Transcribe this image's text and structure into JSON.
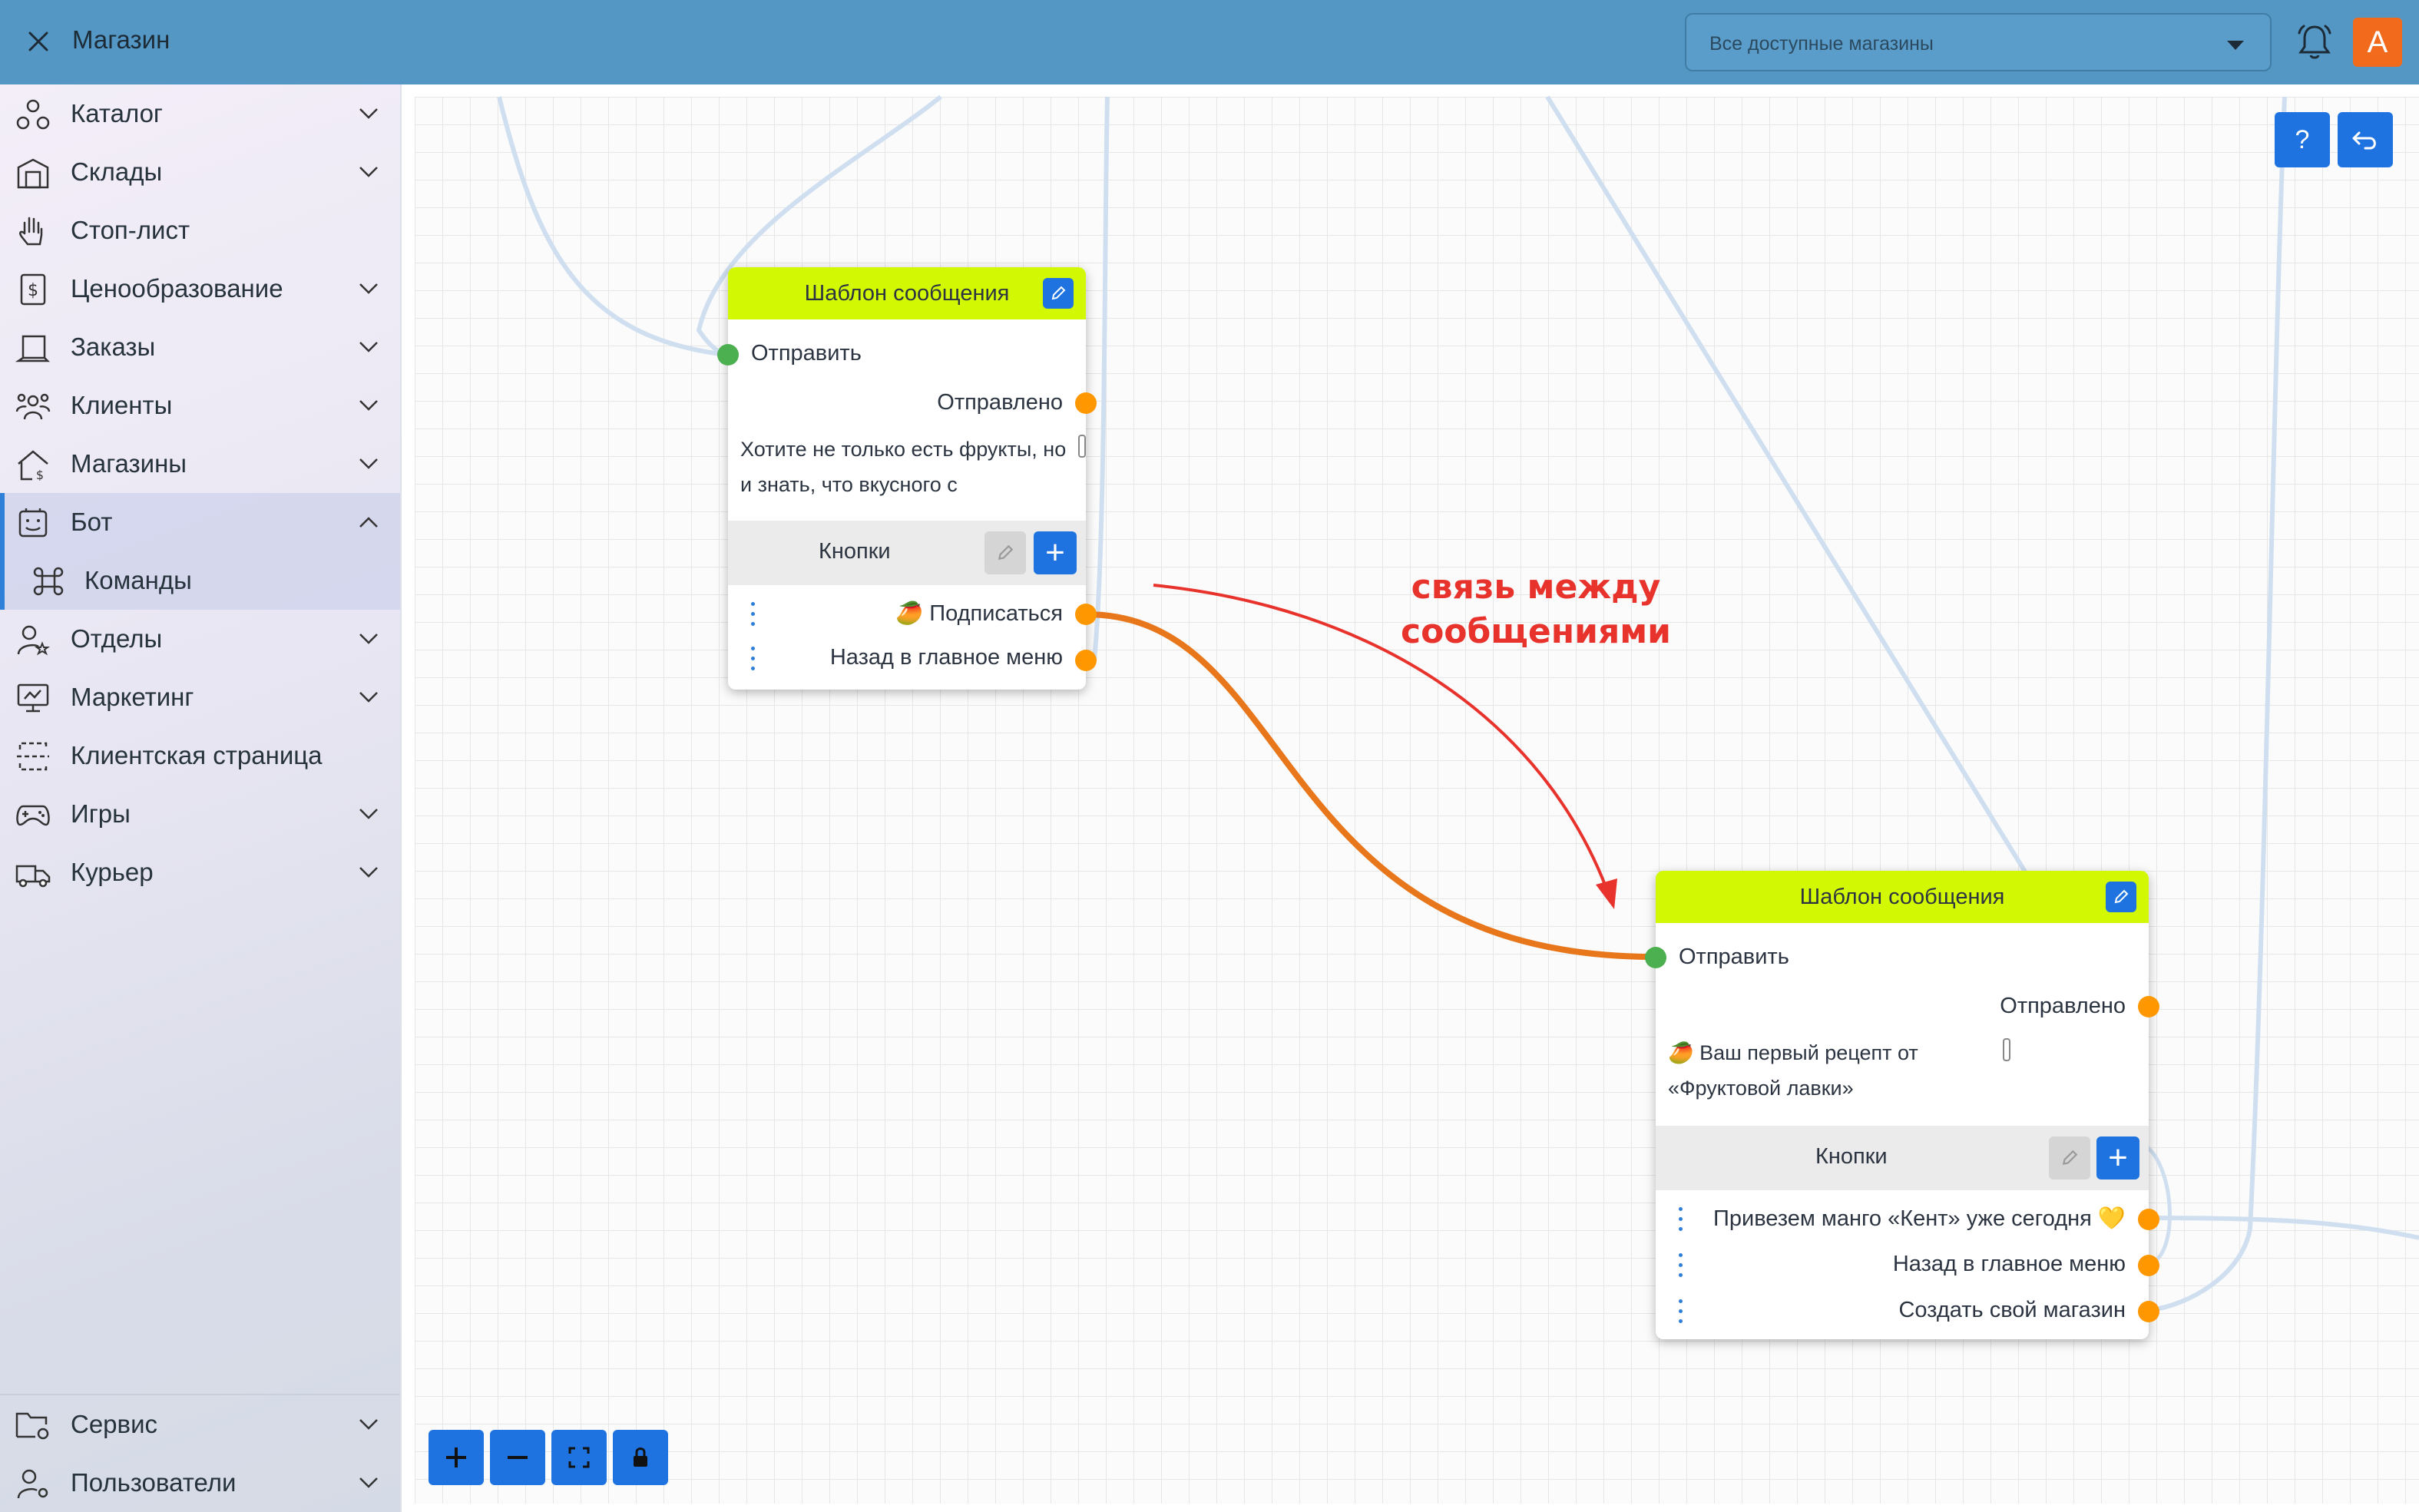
{
  "header": {
    "title": "Магазин",
    "shop_select": {
      "value": "Все доступные магазины"
    },
    "avatar_letter": "А"
  },
  "sidebar": {
    "items": [
      {
        "label": "Каталог",
        "icon": "catalog-icon"
      },
      {
        "label": "Склады",
        "icon": "warehouse-icon"
      },
      {
        "label": "Стоп-лист",
        "icon": "hand-icon"
      },
      {
        "label": "Ценообразование",
        "icon": "receipt-dollar-icon"
      },
      {
        "label": "Заказы",
        "icon": "orders-icon"
      },
      {
        "label": "Клиенты",
        "icon": "clients-icon"
      },
      {
        "label": "Магазины",
        "icon": "stores-icon"
      },
      {
        "label": "Бот",
        "icon": "bot-icon"
      },
      {
        "label": "Команды",
        "icon": "command-icon"
      },
      {
        "label": "Отделы",
        "icon": "departments-icon"
      },
      {
        "label": "Маркетинг",
        "icon": "marketing-icon"
      },
      {
        "label": "Клиентская страница",
        "icon": "client-page-icon"
      },
      {
        "label": "Игры",
        "icon": "gamepad-icon"
      },
      {
        "label": "Курьер",
        "icon": "courier-truck-icon"
      }
    ],
    "bottom_items": [
      {
        "label": "Сервис",
        "icon": "service-folder-icon"
      },
      {
        "label": "Пользователи",
        "icon": "users-gear-icon"
      }
    ]
  },
  "canvas": {
    "help_label": "?",
    "annotation": "связь между сообщениями"
  },
  "node1": {
    "title": "Шаблон сообщения",
    "input_label": "Отправить",
    "output_label": "Отправлено",
    "message": "Хотите не только есть фрукты, но и знать, что вкусного с",
    "buttons_label": "Кнопки",
    "buttons": [
      "🥭 Подписаться",
      "Назад в главное меню"
    ]
  },
  "node2": {
    "title": "Шаблон сообщения",
    "input_label": "Отправить",
    "output_label": "Отправлено",
    "message": "🥭 Ваш первый рецепт от «Фруктовой лавки»",
    "buttons_label": "Кнопки",
    "buttons": [
      "Привезем манго «Кент» уже сегодня 💛",
      "Назад в главное меню",
      "Создать свой магазин"
    ]
  },
  "colors": {
    "header": "#5497c4",
    "node_header": "#d3f803",
    "accent": "#1f73e0",
    "connection": "#e8761a",
    "annotation": "#e8322c",
    "port_in": "#4caf50",
    "port_out": "#ff9800"
  }
}
